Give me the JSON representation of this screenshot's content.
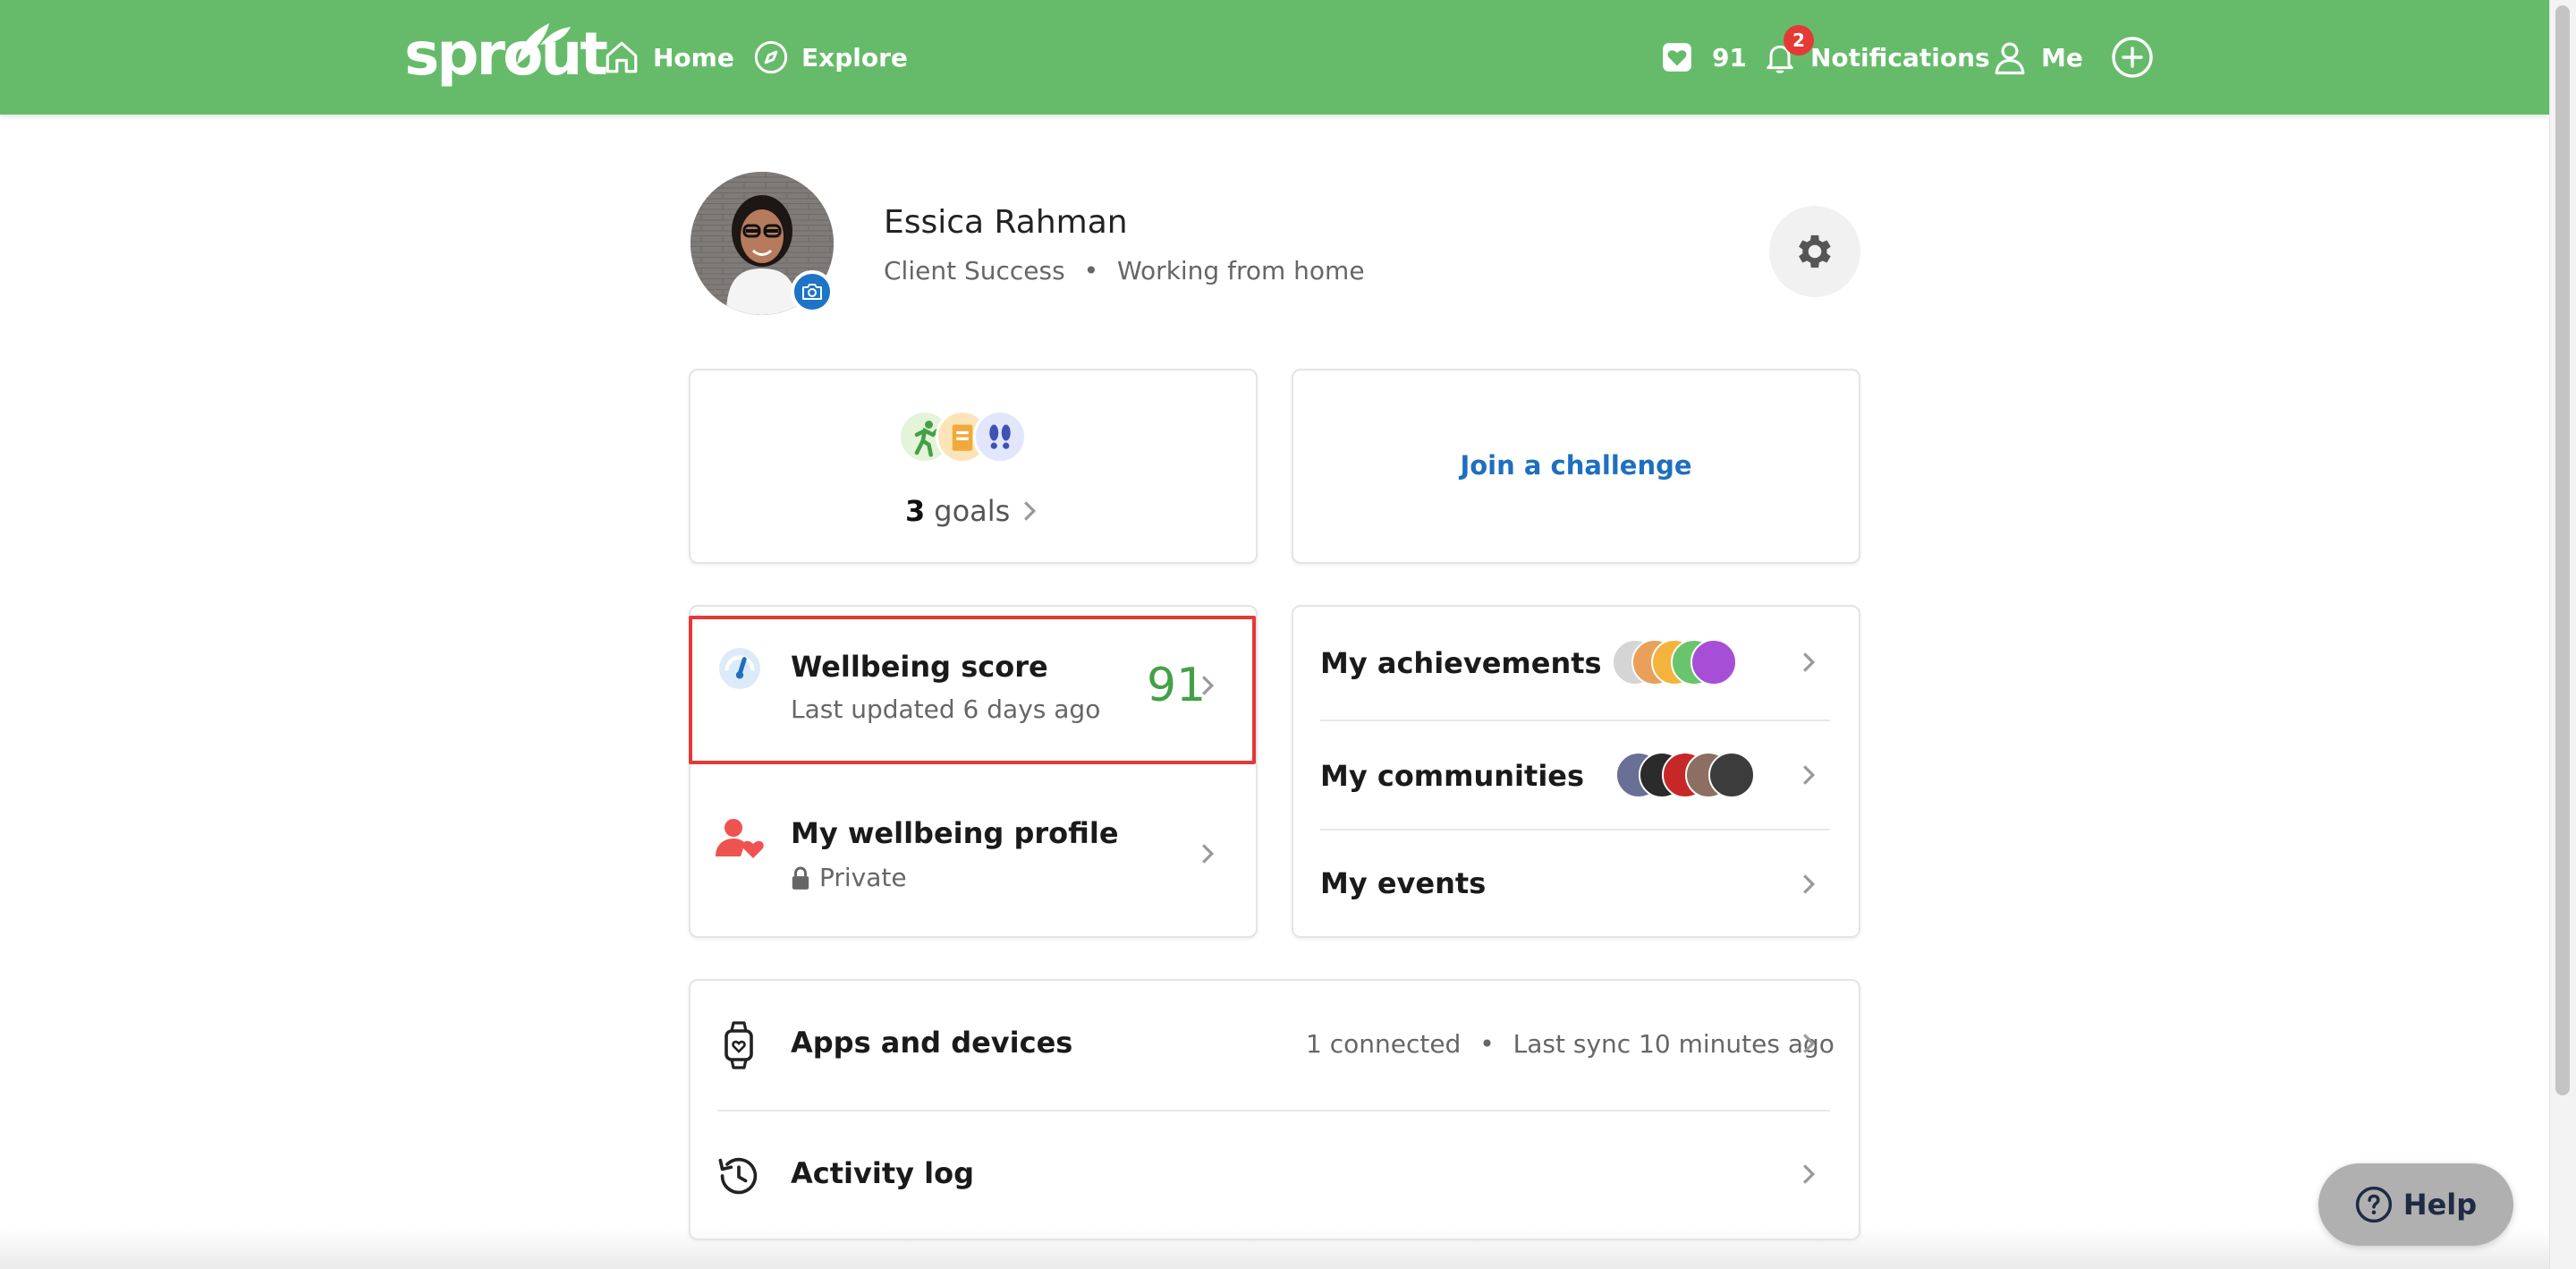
{
  "nav": {
    "logo": "sprout",
    "home_label": "Home",
    "explore_label": "Explore",
    "points": "91",
    "notifications_count": "2",
    "notifications_label": "Notifications",
    "me_label": "Me"
  },
  "profile": {
    "name": "Essica Rahman",
    "department": "Client Success",
    "separator": "•",
    "status": "Working from home"
  },
  "goals": {
    "count": "3",
    "label": "goals"
  },
  "challenge": {
    "label": "Join a challenge"
  },
  "wellbeing_score": {
    "title": "Wellbeing score",
    "updated": "Last updated 6 days ago",
    "score": "91"
  },
  "wellbeing_profile": {
    "title": "My wellbeing profile",
    "privacy": "Private"
  },
  "links": {
    "achievements": "My achievements",
    "communities": "My communities",
    "events": "My events"
  },
  "apps": {
    "title": "Apps and devices",
    "connected": "1 connected",
    "separator": "•",
    "last_sync": "Last sync 10 minutes ago"
  },
  "activity": {
    "title": "Activity log"
  },
  "help": {
    "label": "Help"
  },
  "colors": {
    "brand_green": "#66bb6a",
    "score_green": "#43a047",
    "link_blue": "#1e6fc0",
    "highlight_red": "#e53935"
  }
}
